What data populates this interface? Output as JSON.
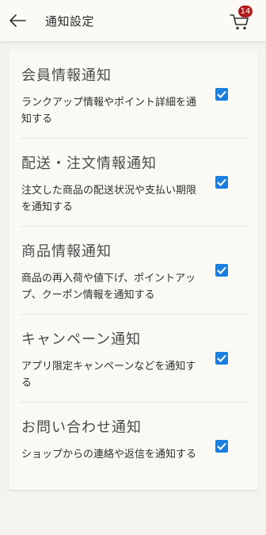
{
  "header": {
    "title": "通知設定",
    "back_icon": "arrow-left-icon",
    "cart_icon": "cart-icon",
    "cart_badge": "14"
  },
  "colors": {
    "background": "#f4f3ee",
    "card": "#faf9f4",
    "checkbox": "#1b7fe0",
    "badge": "#b01c1c"
  },
  "settings": [
    {
      "title": "会員情報通知",
      "description": "ランクアップ情報やポイント詳細を通知する",
      "checked": true
    },
    {
      "title": "配送・注文情報通知",
      "description": "注文した商品の配送状況や支払い期限を通知する",
      "checked": true
    },
    {
      "title": "商品情報通知",
      "description": "商品の再入荷や値下げ、ポイントアップ、クーポン情報を通知する",
      "checked": true
    },
    {
      "title": "キャンペーン通知",
      "description": "アプリ限定キャンペーンなどを通知する",
      "checked": true
    },
    {
      "title": "お問い合わせ通知",
      "description": "ショップからの連絡や返信を通知する",
      "checked": true
    }
  ]
}
